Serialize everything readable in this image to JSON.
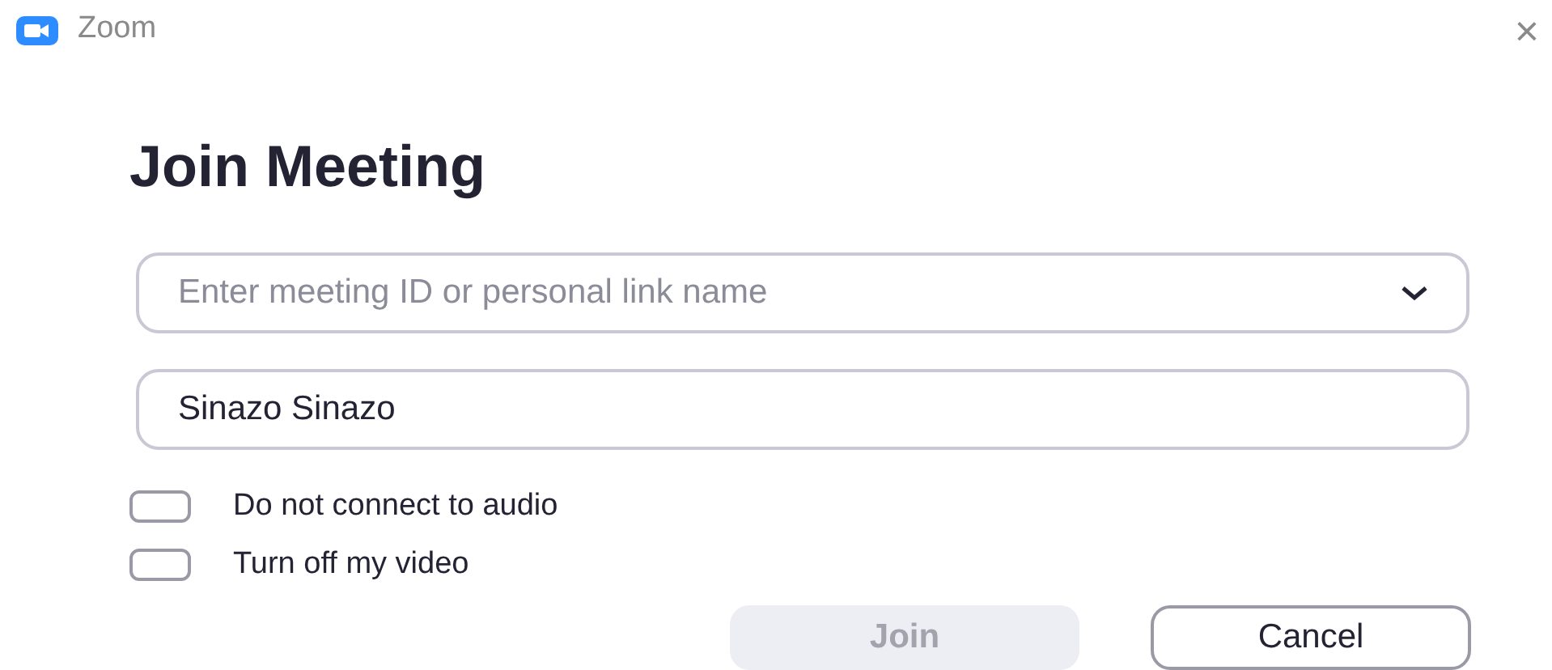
{
  "window": {
    "title": "Zoom",
    "close": "×"
  },
  "heading": "Join Meeting",
  "meeting_field": {
    "placeholder": "Enter meeting ID or personal link name"
  },
  "name_field": {
    "value": "Sinazo Sinazo"
  },
  "options": [
    {
      "label": "Do not connect to audio",
      "checked": false
    },
    {
      "label": "Turn off my video",
      "checked": false
    }
  ],
  "buttons": [
    {
      "label": "Join",
      "kind": "primary",
      "disabled": true
    },
    {
      "label": "Cancel",
      "kind": "secondary",
      "disabled": false
    }
  ]
}
